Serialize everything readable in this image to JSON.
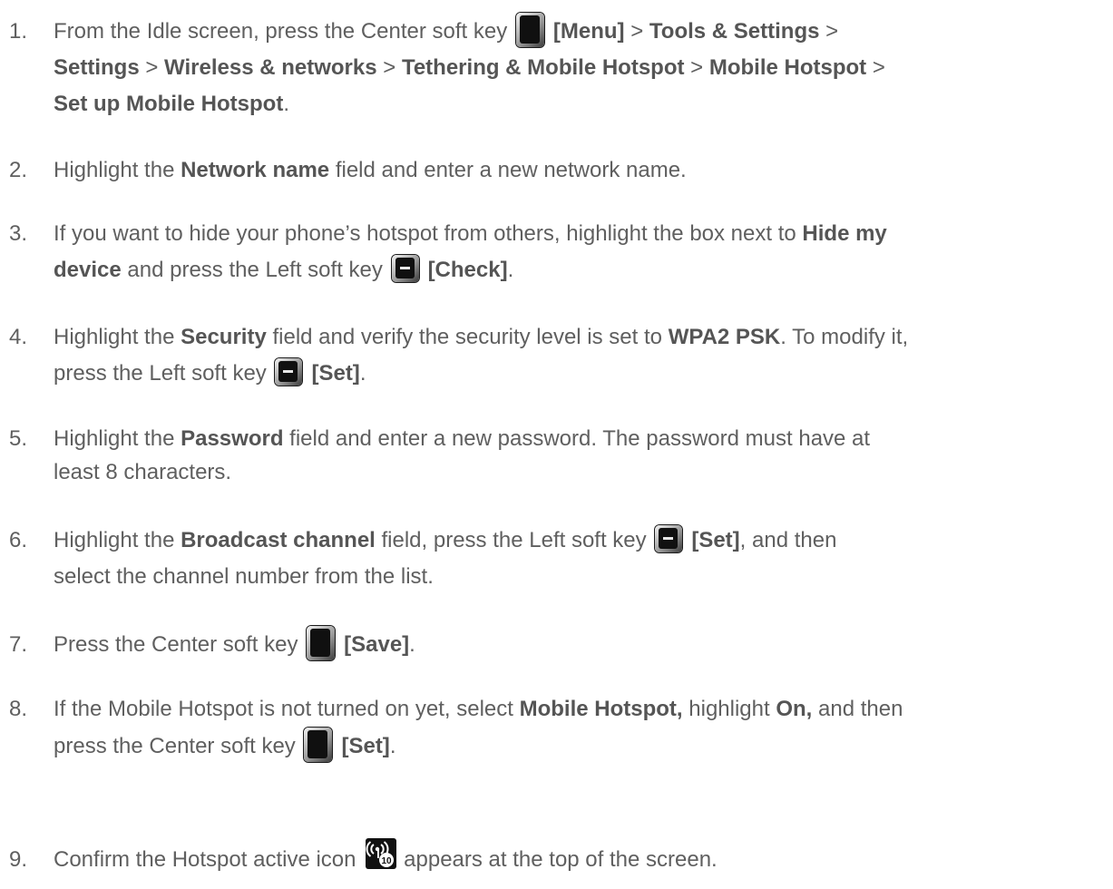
{
  "steps": [
    {
      "num": "1.",
      "lines": [
        [
          "From the Idle screen, press the Center soft key",
          "[Menu]",
          " > ",
          "Tools & Settings",
          " >"
        ],
        [
          "Settings",
          " > ",
          "Wireless & networks",
          " > ",
          "Tethering & Mobile Hotspot",
          " > ",
          "Mobile Hotspot",
          " >"
        ],
        [
          "Set up Mobile Hotspot",
          "."
        ]
      ]
    },
    {
      "num": "2.",
      "text": [
        "Highlight the ",
        "Network name",
        " field and enter a new network name."
      ]
    },
    {
      "num": "3.",
      "lines": [
        [
          "If you want to hide your phone’s hotspot from others, highlight the box next to ",
          "Hide my"
        ],
        [
          "device",
          " and press the Left soft key",
          "[Check]",
          "."
        ]
      ]
    },
    {
      "num": "4.",
      "lines": [
        [
          "Highlight the ",
          "Security",
          " field and verify the security level is set to ",
          "WPA2 PSK",
          ". To modify it,"
        ],
        [
          "press the Left soft key",
          "[Set]",
          "."
        ]
      ]
    },
    {
      "num": "5.",
      "lines": [
        [
          "Highlight the ",
          "Password",
          " field and enter a new password. The password must have at"
        ],
        [
          "least 8 characters."
        ]
      ]
    },
    {
      "num": "6.",
      "lines": [
        [
          "Highlight the ",
          "Broadcast channel",
          " field, press the Left soft key",
          "[Set]",
          ", and then"
        ],
        [
          "select the channel number from the list."
        ]
      ]
    },
    {
      "num": "7.",
      "text": [
        "Press the Center soft key",
        "[Save]",
        "."
      ]
    },
    {
      "num": "8.",
      "lines": [
        [
          "If the Mobile Hotspot is not turned on yet, select ",
          "Mobile Hotspot,",
          " highlight ",
          "On,",
          " and then"
        ],
        [
          "press the Center soft key",
          "[Set]",
          "."
        ]
      ]
    },
    {
      "num": "9.",
      "text": [
        "Confirm the Hotspot active icon",
        "appears at the top of the screen."
      ]
    }
  ],
  "icons": {
    "center_key": "center-soft-key-icon",
    "left_key": "left-soft-key-icon",
    "hotspot": "hotspot-active-icon",
    "hotspot_badge": "10"
  }
}
